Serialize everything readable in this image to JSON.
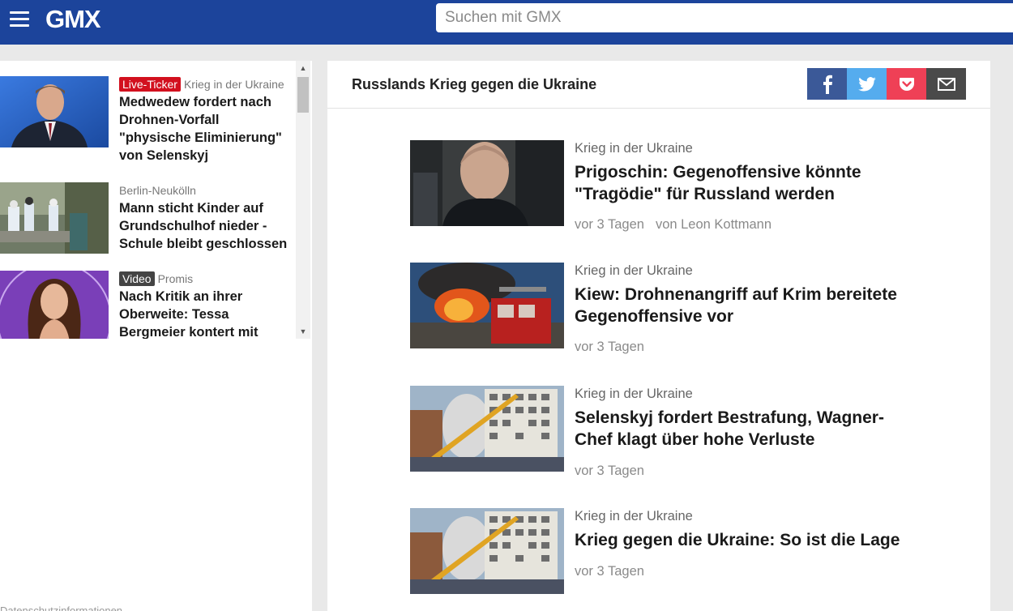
{
  "header": {
    "logo": "GMX",
    "search_placeholder": "Suchen mit GMX"
  },
  "sidebar": {
    "items": [
      {
        "badge": "Live-Ticker",
        "category": "Krieg in der Ukraine",
        "title": "Medwedew fordert nach Drohnen-Vorfall \"physische Eliminierung\" von Selenskyj"
      },
      {
        "badge": "",
        "category": "Berlin-Neukölln",
        "title": "Mann sticht Kinder auf Grundschulhof nieder - Schule bleibt geschlossen"
      },
      {
        "badge": "Video",
        "category": "Promis",
        "title": "Nach Kritik an ihrer Oberweite: Tessa Bergmeier kontert mit"
      }
    ],
    "cut_text": "Datenschutzinformationen"
  },
  "main": {
    "section_title": "Russlands Krieg gegen die Ukraine",
    "share": {
      "facebook": "f",
      "twitter": "twitter",
      "pocket": "pocket",
      "mail": "mail"
    },
    "articles": [
      {
        "kicker": "Krieg in der Ukraine",
        "headline": "Prigoschin: Gegenoffensive könnte \"Tragödie\" für Russland werden",
        "time": "vor 3 Tagen",
        "author": "von Leon Kottmann"
      },
      {
        "kicker": "Krieg in der Ukraine",
        "headline": "Kiew: Drohnenangriff auf Krim bereitete Gegenoffensive vor",
        "time": "vor 3 Tagen",
        "author": ""
      },
      {
        "kicker": "Krieg in der Ukraine",
        "headline": "Selenskyj fordert Bestrafung, Wagner-Chef klagt über hohe Verluste",
        "time": "vor 3 Tagen",
        "author": ""
      },
      {
        "kicker": "Krieg in der Ukraine",
        "headline": "Krieg gegen die Ukraine: So ist die Lage",
        "time": "vor 3 Tagen",
        "author": ""
      }
    ]
  },
  "colors": {
    "header": "#1c449b",
    "live_badge": "#d2101e",
    "facebook": "#3b5998",
    "twitter": "#55acee",
    "pocket": "#ef4056",
    "mail": "#4a4a4a"
  }
}
